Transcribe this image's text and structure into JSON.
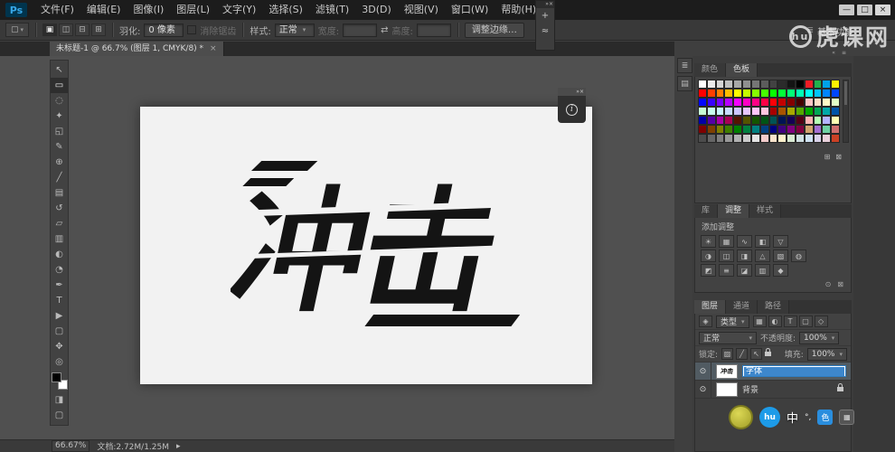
{
  "titlebar": {
    "logo": "Ps",
    "menus": [
      "文件(F)",
      "编辑(E)",
      "图像(I)",
      "图层(L)",
      "文字(Y)",
      "选择(S)",
      "滤镜(T)",
      "3D(D)",
      "视图(V)",
      "窗口(W)",
      "帮助(H)"
    ],
    "window_buttons": [
      {
        "name": "minimize-button",
        "glyph": "—"
      },
      {
        "name": "maximize-button",
        "glyph": "□"
      },
      {
        "name": "close-button",
        "glyph": "×"
      }
    ]
  },
  "options_bar": {
    "tool_preset_glyph": "▢",
    "caret": "▾",
    "boolean_ops": [
      {
        "name": "new-selection-icon",
        "glyph": "▣"
      },
      {
        "name": "add-to-selection-icon",
        "glyph": "◫"
      },
      {
        "name": "subtract-from-selection-icon",
        "glyph": "⊟"
      },
      {
        "name": "intersect-selection-icon",
        "glyph": "⊞"
      }
    ],
    "feather_label": "羽化:",
    "feather_value": "0 像素",
    "antialias_label": "消除锯齿",
    "style_label": "样式:",
    "style_value": "正常",
    "width_label": "宽度:",
    "width_value": "",
    "swap_glyph": "⇄",
    "height_label": "高度:",
    "height_value": "",
    "refine_edge_label": "调整边缘…",
    "workspace_grid_glyph": "≣",
    "workspace_label": "基本功能"
  },
  "document_tab": {
    "title": "未标题-1 @ 66.7% (图层 1, CMYK/8) *",
    "close_glyph": "×"
  },
  "canvas": {
    "artwork_text": "冲击"
  },
  "toolbar": {
    "fg_color": "#000000",
    "bg_color": "#ffffff",
    "tools": [
      {
        "name": "move-tool",
        "glyph": "↖"
      },
      {
        "name": "rectangular-marquee-tool",
        "glyph": "▭"
      },
      {
        "name": "lasso-tool",
        "glyph": "◌"
      },
      {
        "name": "quick-selection-tool",
        "glyph": "✦"
      },
      {
        "name": "crop-tool",
        "glyph": "◱"
      },
      {
        "name": "eyedropper-tool",
        "glyph": "✎"
      },
      {
        "name": "spot-healing-brush-tool",
        "glyph": "⊕"
      },
      {
        "name": "brush-tool",
        "glyph": "╱"
      },
      {
        "name": "clone-stamp-tool",
        "glyph": "▤"
      },
      {
        "name": "history-brush-tool",
        "glyph": "↺"
      },
      {
        "name": "eraser-tool",
        "glyph": "▱"
      },
      {
        "name": "gradient-tool",
        "glyph": "▥"
      },
      {
        "name": "blur-tool",
        "glyph": "◐"
      },
      {
        "name": "dodge-tool",
        "glyph": "◔"
      },
      {
        "name": "pen-tool",
        "glyph": "✒"
      },
      {
        "name": "horizontal-type-tool",
        "glyph": "T"
      },
      {
        "name": "path-selection-tool",
        "glyph": "▶"
      },
      {
        "name": "rectangle-tool",
        "glyph": "▢"
      },
      {
        "name": "hand-tool",
        "glyph": "✥"
      },
      {
        "name": "zoom-tool",
        "glyph": "◎"
      }
    ],
    "extras": [
      {
        "name": "quick-mask-icon",
        "glyph": "◨"
      },
      {
        "name": "screen-mode-icon",
        "glyph": "▢"
      }
    ]
  },
  "mini_panel": {
    "header_glyph": "»×",
    "icons": [
      {
        "name": "eyedropper-sample-icon",
        "glyph": "+"
      },
      {
        "name": "ruler-icon",
        "glyph": "≈"
      }
    ]
  },
  "info_panel": {
    "header_glyph": "»×",
    "info_glyph": "i"
  },
  "dock_buttons": [
    {
      "name": "history-panel-icon",
      "glyph": "≣"
    },
    {
      "name": "properties-panel-icon",
      "glyph": "▤"
    }
  ],
  "panels": {
    "dock_header_icons": [
      {
        "name": "collapse-dock-icon",
        "glyph": "«"
      },
      {
        "name": "dock-menu-icon",
        "glyph": "≡"
      }
    ],
    "swatches": {
      "tabs": [
        {
          "label": "颜色",
          "active": false
        },
        {
          "label": "色板",
          "active": true
        }
      ],
      "footer_icons": [
        {
          "name": "new-swatch-icon",
          "glyph": "⊞"
        },
        {
          "name": "delete-swatch-icon",
          "glyph": "⊠"
        }
      ],
      "colors": [
        [
          "#ffffff",
          "#ebebeb",
          "#d6d6d6",
          "#c0c0c0",
          "#a8a8a8",
          "#8f8f8f",
          "#757575",
          "#5c5c5c",
          "#424242",
          "#2b2b2b",
          "#141414",
          "#000000",
          "#ee1c25",
          "#22b14c",
          "#00a2e8",
          "#fff200"
        ],
        [
          "#ff0000",
          "#ff3f00",
          "#ff7e00",
          "#ffbd00",
          "#fffc00",
          "#c4ff00",
          "#85ff00",
          "#46ff00",
          "#07ff00",
          "#00ff37",
          "#00ff76",
          "#00ffb5",
          "#00fff4",
          "#00c4ff",
          "#0085ff",
          "#0046ff"
        ],
        [
          "#0007ff",
          "#3700ff",
          "#7600ff",
          "#b500ff",
          "#f400ff",
          "#ff00c4",
          "#ff0085",
          "#ff0046",
          "#ff0007",
          "#c40000",
          "#850000",
          "#460000",
          "#ffc6c6",
          "#ffdfc6",
          "#fff9c6",
          "#e2ffc6"
        ],
        [
          "#c6ffd4",
          "#c6ffee",
          "#c6f6ff",
          "#c6ddff",
          "#cdc6ff",
          "#e7c6ff",
          "#ffc6f9",
          "#ffc6df",
          "#a80000",
          "#a85400",
          "#a8a800",
          "#54a800",
          "#00a800",
          "#00a854",
          "#00a8a8",
          "#0054a8"
        ],
        [
          "#0000a8",
          "#5400a8",
          "#a800a8",
          "#a80054",
          "#541400",
          "#545400",
          "#145400",
          "#005414",
          "#005454",
          "#001454",
          "#140054",
          "#540014",
          "#ffb4b4",
          "#b4ffb4",
          "#b4b4ff",
          "#ffffb4"
        ],
        [
          "#7f0000",
          "#7f3f00",
          "#7f7f00",
          "#3f7f00",
          "#007f00",
          "#007f3f",
          "#007f7f",
          "#003f7f",
          "#00007f",
          "#3f007f",
          "#7f007f",
          "#7f003f",
          "#d1a36e",
          "#a36ed1",
          "#6ed1a3",
          "#d16e6e"
        ],
        [
          "#4c4c4c",
          "#666666",
          "#7f7f7f",
          "#999999",
          "#b2b2b2",
          "#cccccc",
          "#e5e5e5",
          "#f4cccc",
          "#fce5cd",
          "#fff2cc",
          "#d9ead3",
          "#d0e0e3",
          "#cfe2f3",
          "#d9d2e9",
          "#ead1dc",
          "#cc4125"
        ]
      ]
    },
    "adjustments": {
      "tabs": [
        {
          "label": "库",
          "active": false
        },
        {
          "label": "调整",
          "active": true
        },
        {
          "label": "样式",
          "active": false
        }
      ],
      "title": "添加调整",
      "rows": [
        [
          {
            "name": "brightness-contrast-icon",
            "glyph": "☀"
          },
          {
            "name": "levels-icon",
            "glyph": "▦"
          },
          {
            "name": "curves-icon",
            "glyph": "∿"
          },
          {
            "name": "exposure-icon",
            "glyph": "◧"
          },
          {
            "name": "vibrance-icon",
            "glyph": "▽"
          }
        ],
        [
          {
            "name": "hue-saturation-icon",
            "glyph": "◑"
          },
          {
            "name": "color-balance-icon",
            "glyph": "◫"
          },
          {
            "name": "black-white-icon",
            "glyph": "◨"
          },
          {
            "name": "photo-filter-icon",
            "glyph": "△"
          },
          {
            "name": "channel-mixer-icon",
            "glyph": "▧"
          },
          {
            "name": "color-lookup-icon",
            "glyph": "◍"
          }
        ],
        [
          {
            "name": "invert-icon",
            "glyph": "◩"
          },
          {
            "name": "posterize-icon",
            "glyph": "≡"
          },
          {
            "name": "threshold-icon",
            "glyph": "◪"
          },
          {
            "name": "gradient-map-icon",
            "glyph": "▥"
          },
          {
            "name": "selective-color-icon",
            "glyph": "◆"
          }
        ]
      ],
      "footer_icons": [
        {
          "name": "clip-adjustment-icon",
          "glyph": "⊙"
        },
        {
          "name": "delete-adjustment-icon",
          "glyph": "⊠"
        }
      ]
    },
    "layers": {
      "tabs": [
        {
          "label": "图层",
          "active": true
        },
        {
          "label": "通道",
          "active": false
        },
        {
          "label": "路径",
          "active": false
        }
      ],
      "filter_kind_glyph": "◈",
      "filter_label": "类型",
      "filter_icons": [
        {
          "name": "pixel-layer-filter-icon",
          "glyph": "▦"
        },
        {
          "name": "adjustment-layer-filter-icon",
          "glyph": "◐"
        },
        {
          "name": "type-layer-filter-icon",
          "glyph": "T"
        },
        {
          "name": "shape-layer-filter-icon",
          "glyph": "▢"
        },
        {
          "name": "smart-object-filter-icon",
          "glyph": "◇"
        }
      ],
      "blend_mode": "正常",
      "opacity_label": "不透明度:",
      "opacity_value": "100%",
      "lock_label": "锁定:",
      "lock_icons": [
        {
          "name": "lock-transparency-icon",
          "glyph": "▨"
        },
        {
          "name": "lock-pixels-icon",
          "glyph": "╱"
        },
        {
          "name": "lock-position-icon",
          "glyph": "↖"
        },
        {
          "name": "lock-all-icon",
          "glyph": "lock"
        }
      ],
      "fill_label": "填充:",
      "fill_value": "100%",
      "eye_glyph": "⊙",
      "items": [
        {
          "name": "字体",
          "selected": true,
          "thumb": "art",
          "locked": false
        },
        {
          "name": "背景",
          "selected": false,
          "thumb": "white",
          "locked": true
        }
      ]
    }
  },
  "statusbar": {
    "zoom": "66.67%",
    "doc_info": "文档:2.72M/1.25M",
    "arrow_glyph": "▸"
  },
  "watermark": {
    "logo_glyph": "hu",
    "text": "虎课网"
  },
  "ime": {
    "logo": "hu",
    "mode": "中",
    "punct": "°,",
    "color_badge": "色",
    "kbd_glyph": "▦"
  }
}
